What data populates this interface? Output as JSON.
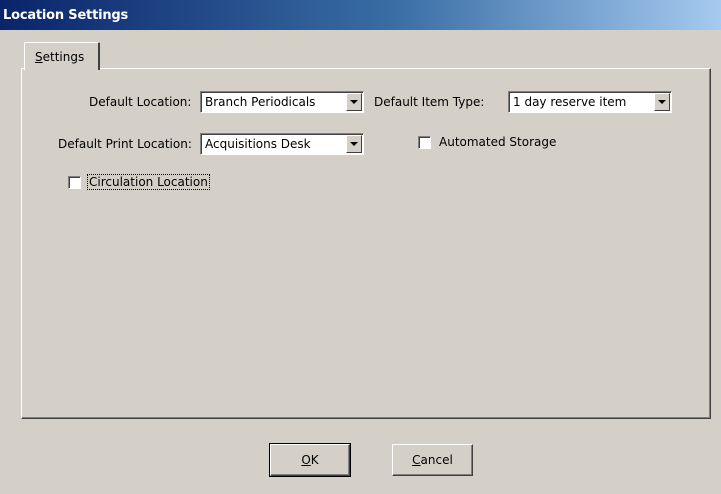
{
  "window": {
    "title": "Location Settings"
  },
  "tabs": [
    {
      "label": "Settings",
      "accesskey_index": 0
    }
  ],
  "form": {
    "default_location": {
      "label": "Default Location:",
      "value": "Branch Periodicals"
    },
    "default_print_location": {
      "label": "Default Print Location:",
      "value": "Acquisitions Desk"
    },
    "default_item_type": {
      "label": "Default Item Type:",
      "value": "1 day reserve item"
    },
    "automated_storage": {
      "label": "Automated Storage",
      "checked": false
    },
    "circulation_location": {
      "label": "Circulation Location",
      "checked": false
    }
  },
  "buttons": {
    "ok": {
      "label": "OK"
    },
    "cancel": {
      "label": "Cancel"
    }
  }
}
